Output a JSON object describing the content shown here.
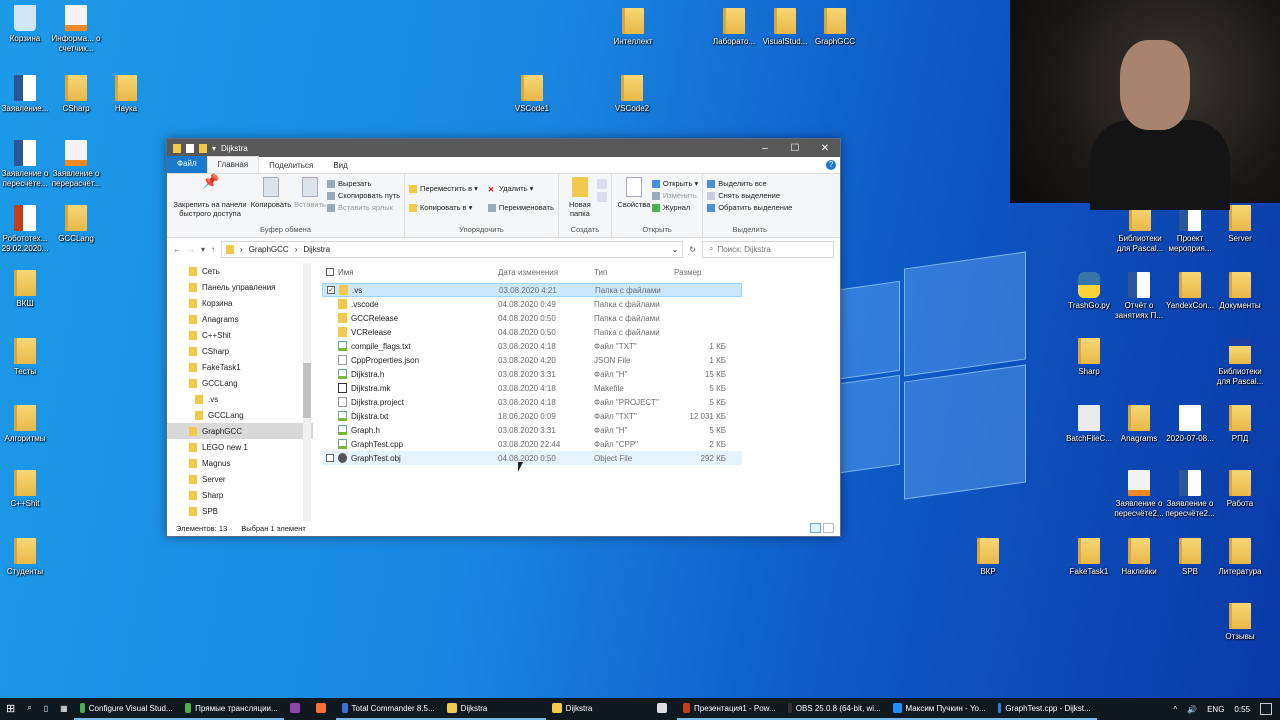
{
  "desktop": {
    "icons": [
      {
        "label": "Корзина",
        "icon": "recycle-bin"
      },
      {
        "label": "Информа... о счетчик...",
        "icon": "doc"
      },
      {
        "label": "Заявление...",
        "icon": "word"
      },
      {
        "label": "CSharp",
        "icon": "folder"
      },
      {
        "label": "Наука",
        "icon": "folder"
      },
      {
        "label": "Заявление о пересчёте...",
        "icon": "word"
      },
      {
        "label": "Заявление о перерасчёт...",
        "icon": "doc"
      },
      {
        "label": "Робототех... 29.02.2020...",
        "icon": "ppt"
      },
      {
        "label": "GCCLang",
        "icon": "folder"
      },
      {
        "label": "ВКШ",
        "icon": "folder"
      },
      {
        "label": "Тесты",
        "icon": "folder"
      },
      {
        "label": "Алгоритмы",
        "icon": "folder"
      },
      {
        "label": "C++Shit",
        "icon": "folder"
      },
      {
        "label": "Студенты",
        "icon": "folder"
      },
      {
        "label": "VSCode1",
        "icon": "folder"
      },
      {
        "label": "VSCode2",
        "icon": "folder"
      },
      {
        "label": "Интеллект",
        "icon": "folder"
      },
      {
        "label": "Лаборато...",
        "icon": "folder"
      },
      {
        "label": "VisualStud...",
        "icon": "folder"
      },
      {
        "label": "GraphGCC",
        "icon": "folder"
      },
      {
        "label": "Библиотеки для Pascal...",
        "icon": "folder"
      },
      {
        "label": "Проект мероприя...",
        "icon": "word"
      },
      {
        "label": "Server",
        "icon": "folder"
      },
      {
        "label": "TrashGo.py",
        "icon": "py"
      },
      {
        "label": "Отчёт о занятиях П...",
        "icon": "word"
      },
      {
        "label": "YandexCon...",
        "icon": "folder"
      },
      {
        "label": "Документы",
        "icon": "folder"
      },
      {
        "label": "Sharp",
        "icon": "folder"
      },
      {
        "label": "Библиотеки для Pascal...",
        "icon": "zfolder"
      },
      {
        "label": "BatchFileC...",
        "icon": "gear"
      },
      {
        "label": "Anagrams",
        "icon": "folder"
      },
      {
        "label": "2020-07-08...",
        "icon": "file"
      },
      {
        "label": "РПД",
        "icon": "folder"
      },
      {
        "label": "Заявление о пересчёте2...",
        "icon": "doc"
      },
      {
        "label": "Заявление о пересчёте2...",
        "icon": "word"
      },
      {
        "label": "Работа",
        "icon": "folder"
      },
      {
        "label": "ВКР",
        "icon": "folder"
      },
      {
        "label": "FakeTask1",
        "icon": "folder"
      },
      {
        "label": "Наклейки",
        "icon": "folder"
      },
      {
        "label": "SPB",
        "icon": "folder"
      },
      {
        "label": "Литература",
        "icon": "folder"
      },
      {
        "label": "Отзывы",
        "icon": "folder"
      }
    ]
  },
  "explorer": {
    "title": "Dijkstra",
    "tabs": [
      "Файл",
      "Главная",
      "Поделиться",
      "Вид"
    ],
    "help": "?",
    "ribbon": {
      "clipboard": {
        "pin": "Закрепить на панели быстрого доступа",
        "copy": "Копировать",
        "paste": "Вставить",
        "cut": "Вырезать",
        "copy_path": "Скопировать путь",
        "paste_shortcut": "Вставить ярлык",
        "label": "Буфер обмена"
      },
      "organize": {
        "move": "Переместить в ▾",
        "copy_to": "Копировать в ▾",
        "delete": "Удалить ▾",
        "rename": "Переименовать",
        "label": "Упорядочить"
      },
      "create": {
        "new_folder": "Новая папка",
        "label": "Создать"
      },
      "open": {
        "properties": "Свойства",
        "open": "Открыть ▾",
        "edit": "Изменить",
        "history": "Журнал",
        "label": "Открыть"
      },
      "select": {
        "all": "Выделить все",
        "none": "Снять выделение",
        "invert": "Обратить выделение",
        "label": "Выделить"
      }
    },
    "breadcrumb": [
      "GraphGCC",
      "Dijkstra"
    ],
    "search_placeholder": "Поиск: Dijkstra",
    "nav": [
      {
        "label": "Сеть"
      },
      {
        "label": "Панель управления"
      },
      {
        "label": "Корзина"
      },
      {
        "label": "Anagrams"
      },
      {
        "label": "C++Shit"
      },
      {
        "label": "CSharp"
      },
      {
        "label": "FakeTask1"
      },
      {
        "label": "GCCLang"
      },
      {
        "label": ".vs",
        "indent": true
      },
      {
        "label": "GCCLang",
        "indent": true
      },
      {
        "label": "GraphGCC",
        "selected": true
      },
      {
        "label": "LEGO new 1"
      },
      {
        "label": "Magnus"
      },
      {
        "label": "Server"
      },
      {
        "label": "Sharp"
      },
      {
        "label": "SPB"
      }
    ],
    "columns": [
      "Имя",
      "Дата изменения",
      "Тип",
      "Размер"
    ],
    "files": [
      {
        "name": ".vs",
        "date": "03.08.2020 4:21",
        "type": "Папка с файлами",
        "size": "",
        "icon": "folder",
        "selected": true
      },
      {
        "name": ".vscode",
        "date": "04.08.2020 0:49",
        "type": "Папка с файлами",
        "size": "",
        "icon": "folder"
      },
      {
        "name": "GCCRelease",
        "date": "04.08.2020 0:50",
        "type": "Папка с файлами",
        "size": "",
        "icon": "folder"
      },
      {
        "name": "VCRelease",
        "date": "04.08.2020 0:50",
        "type": "Папка с файлами",
        "size": "",
        "icon": "folder"
      },
      {
        "name": "compile_flags.txt",
        "date": "03.08.2020 4:18",
        "type": "Файл \"TXT\"",
        "size": "1 КБ",
        "icon": "txt"
      },
      {
        "name": "CppProperties.json",
        "date": "03.08.2020 4:20",
        "type": "JSON File",
        "size": "1 КБ",
        "icon": "file"
      },
      {
        "name": "Dijkstra.h",
        "date": "03.08.2020 3:31",
        "type": "Файл \"H\"",
        "size": "15 КБ",
        "icon": "txt"
      },
      {
        "name": "Dijkstra.mk",
        "date": "03.08.2020 4:18",
        "type": "Makefile",
        "size": "5 КБ",
        "icon": "mk"
      },
      {
        "name": "Dijkstra.project",
        "date": "03.08.2020 4:18",
        "type": "Файл \"PROJECT\"",
        "size": "5 КБ",
        "icon": "file"
      },
      {
        "name": "Dijkstra.txt",
        "date": "18.06.2020 0:09",
        "type": "Файл \"TXT\"",
        "size": "12 031 КБ",
        "icon": "txt"
      },
      {
        "name": "Graph.h",
        "date": "03.08.2020 3:31",
        "type": "Файл \"H\"",
        "size": "5 КБ",
        "icon": "txt"
      },
      {
        "name": "GraphTest.cpp",
        "date": "03.08.2020 22:44",
        "type": "Файл \"CPP\"",
        "size": "2 КБ",
        "icon": "txt"
      },
      {
        "name": "GraphTest.obj",
        "date": "04.08.2020 0:50",
        "type": "Object File",
        "size": "292 КБ",
        "icon": "obj",
        "hover": true
      }
    ],
    "status": {
      "count": "Элементов: 13",
      "selected": "Выбран 1 элемент"
    }
  },
  "taskbar": {
    "items": [
      {
        "label": "Configure Visual Stud...",
        "color": "#4caf50",
        "state": "open"
      },
      {
        "label": "Прямые трансляции...",
        "color": "#4caf50",
        "state": "open"
      },
      {
        "label": "",
        "color": "#8e44ad",
        "state": ""
      },
      {
        "label": "",
        "color": "#ff7139",
        "state": ""
      },
      {
        "label": "Total Commander 8.5...",
        "color": "#3a6fd8",
        "state": "open"
      },
      {
        "label": "Dijkstra",
        "color": "#f2c94c",
        "state": "open"
      },
      {
        "label": "Dijkstra",
        "color": "#f2c94c",
        "state": "active"
      },
      {
        "label": "",
        "color": "#ddd",
        "state": ""
      },
      {
        "label": "Презентация1 - Pow...",
        "color": "#c43e1c",
        "state": "open"
      },
      {
        "label": "OBS 25.0.8 (64-bit, wi...",
        "color": "#333",
        "state": "open"
      },
      {
        "label": "Максим Пучкин - Yo...",
        "color": "#1e90ff",
        "state": "open"
      },
      {
        "label": "GraphTest.cpp - Dijkst...",
        "color": "#2a7fd4",
        "state": "open"
      }
    ],
    "tray": {
      "chevron": "^",
      "volume": "🔊",
      "lang": "ENG",
      "time": "0:55"
    }
  }
}
